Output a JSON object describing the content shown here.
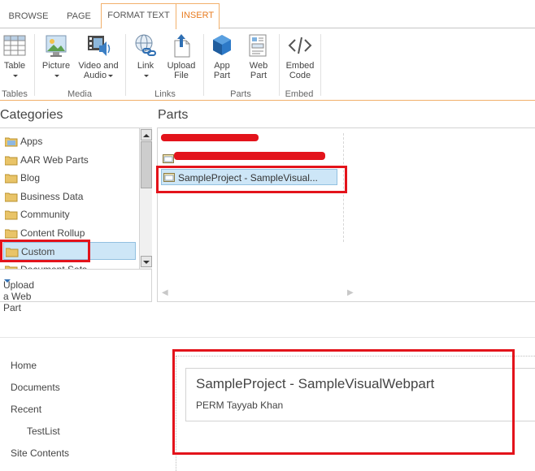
{
  "tabs": [
    {
      "label": "BROWSE"
    },
    {
      "label": "PAGE"
    },
    {
      "label": "FORMAT TEXT"
    },
    {
      "label": "INSERT"
    }
  ],
  "ribbon": {
    "groups": [
      {
        "label": "Tables"
      },
      {
        "label": "Media"
      },
      {
        "label": "Links"
      },
      {
        "label": "Parts"
      },
      {
        "label": "Embed"
      }
    ],
    "buttons": {
      "table": {
        "line1": "Table",
        "line2": ""
      },
      "picture": {
        "line1": "Picture",
        "line2": ""
      },
      "video": {
        "line1": "Video and",
        "line2": "Audio"
      },
      "link": {
        "line1": "Link",
        "line2": ""
      },
      "upload": {
        "line1": "Upload",
        "line2": "File"
      },
      "app_part": {
        "line1": "App",
        "line2": "Part"
      },
      "web_part": {
        "line1": "Web",
        "line2": "Part"
      },
      "embed": {
        "line1": "Embed",
        "line2": "Code"
      }
    }
  },
  "picker": {
    "categories_header": "Categories",
    "parts_header": "Parts",
    "categories": [
      {
        "label": "Apps"
      },
      {
        "label": "AAR Web Parts"
      },
      {
        "label": "Blog"
      },
      {
        "label": "Business Data"
      },
      {
        "label": "Community"
      },
      {
        "label": "Content Rollup"
      },
      {
        "label": "Custom"
      },
      {
        "label": "Document Sets"
      }
    ],
    "selected_category": "Custom",
    "upload_label": "Upload a Web Part",
    "parts": [
      {
        "label": "SampleProject - SampleVisual..."
      }
    ]
  },
  "quick_launch": [
    {
      "label": "Home"
    },
    {
      "label": "Documents"
    },
    {
      "label": "Recent"
    },
    {
      "label": "TestList"
    },
    {
      "label": "Site Contents"
    }
  ],
  "webpart": {
    "title": "SampleProject - SampleVisualWebpart",
    "body": "PERM Tayyab Khan"
  },
  "colors": {
    "accent_orange": "#e87b1f",
    "annotation_red": "#e3131b",
    "selection_blue": "#cde6f7"
  }
}
